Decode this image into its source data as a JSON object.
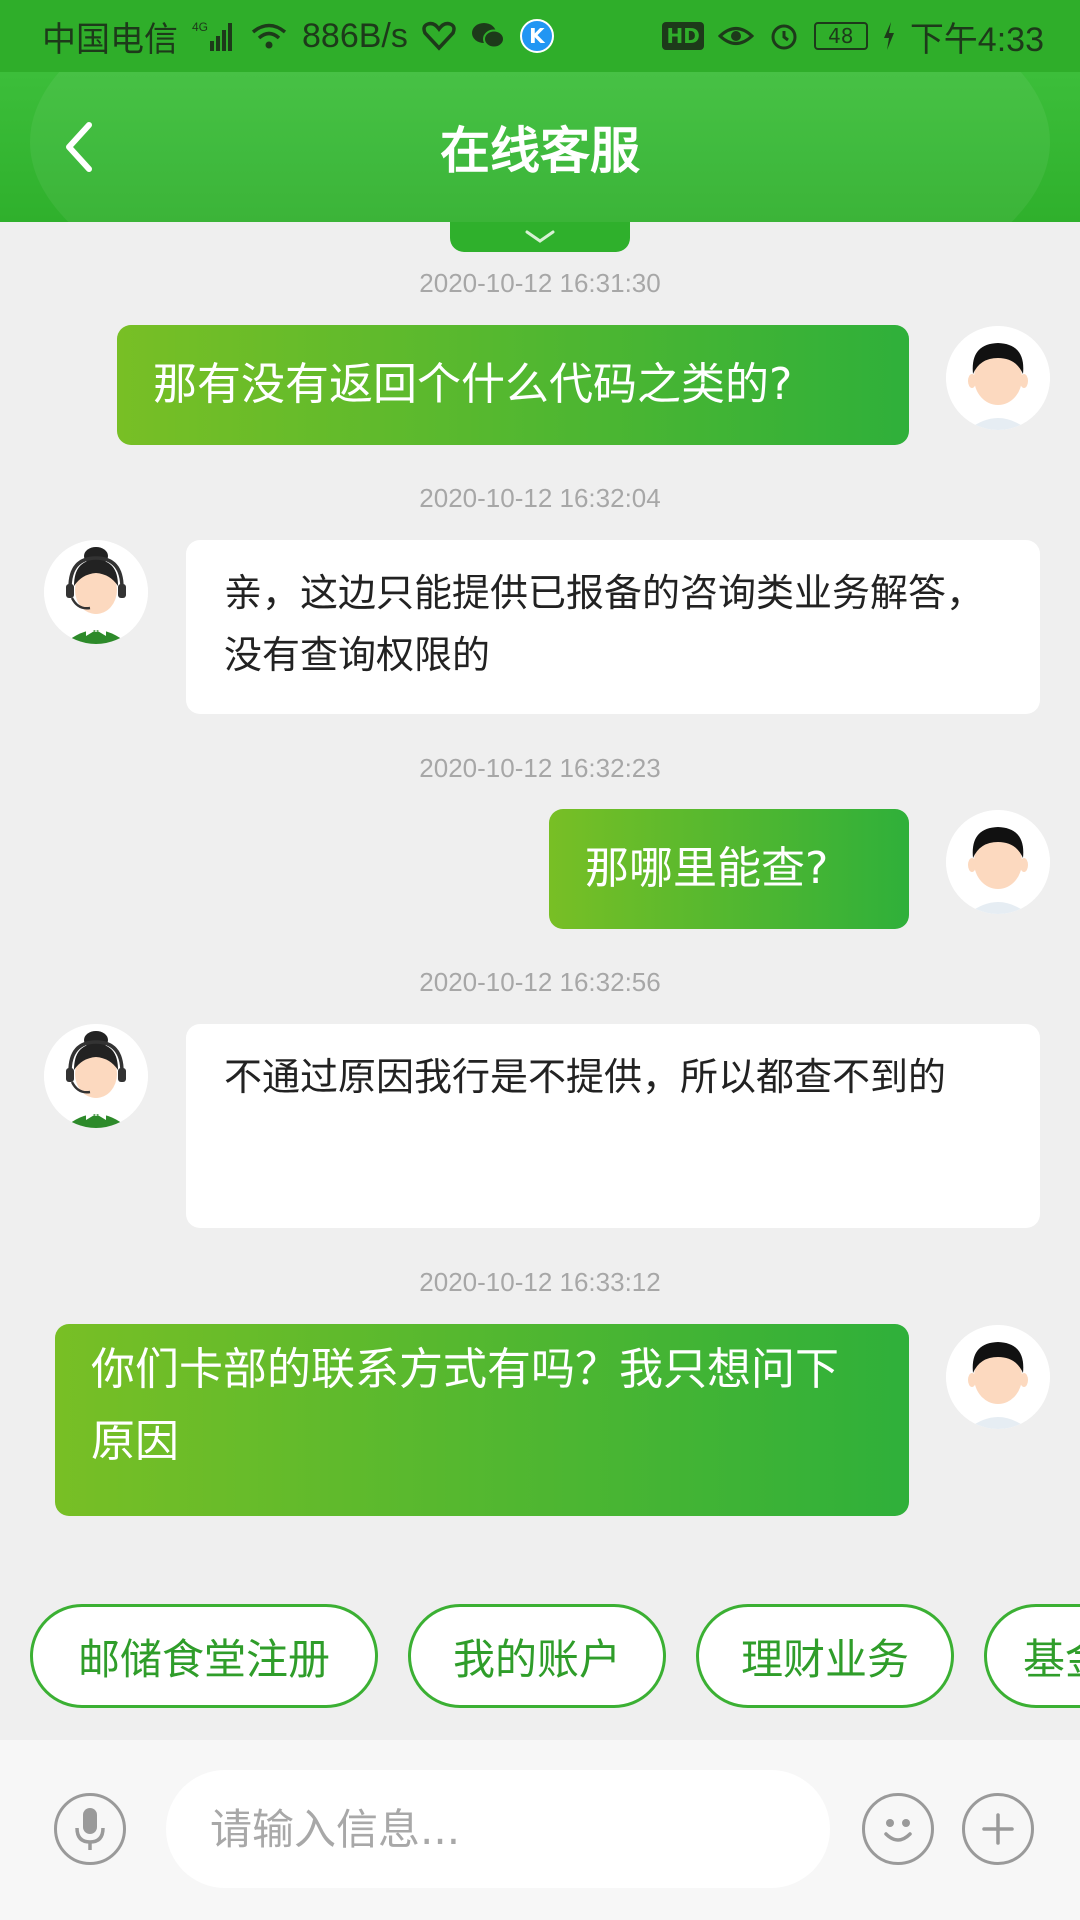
{
  "status_bar": {
    "carrier": "中国电信",
    "network": "4G",
    "speed": "886B/s",
    "battery": "48",
    "time": "下午4:33",
    "hd_label": "HD",
    "k_label": "K"
  },
  "header": {
    "title": "在线客服"
  },
  "messages": [
    {
      "type": "timestamp",
      "text": "2020-10-12 16:31:30"
    },
    {
      "type": "outgoing",
      "text": "那有没有返回个什么代码之类的?"
    },
    {
      "type": "timestamp",
      "text": "2020-10-12 16:32:04"
    },
    {
      "type": "incoming",
      "text": "亲，这边只能提供已报备的咨询类业务解答，没有查询权限的"
    },
    {
      "type": "timestamp",
      "text": "2020-10-12 16:32:23"
    },
    {
      "type": "outgoing",
      "text": "那哪里能查?"
    },
    {
      "type": "timestamp",
      "text": "2020-10-12 16:32:56"
    },
    {
      "type": "incoming",
      "text": "不通过原因我行是不提供，所以都查不到的"
    },
    {
      "type": "timestamp",
      "text": "2020-10-12 16:33:12"
    },
    {
      "type": "outgoing",
      "text": "你们卡部的联系方式有吗？我只想问下原因"
    }
  ],
  "quick_replies": [
    "邮储食堂注册",
    "我的账户",
    "理财业务",
    "基金"
  ],
  "input": {
    "placeholder": "请输入信息..."
  },
  "colors": {
    "brand_green": "#2fb02c",
    "bubble_out_start": "#78bf25",
    "bubble_out_end": "#2fb03a",
    "chip_border": "#3bb033",
    "background": "#efefef"
  },
  "icons": {
    "back": "chevron-left-icon",
    "pull": "chevron-down-icon",
    "voice": "microphone-icon",
    "emoji": "smiley-icon",
    "more": "plus-icon"
  }
}
